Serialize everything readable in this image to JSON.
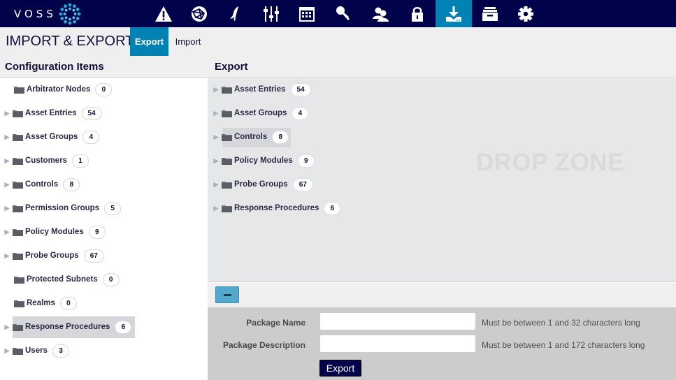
{
  "brand": {
    "name": "VOSS",
    "accent": "#0082b4",
    "nav_bg": "#01034a"
  },
  "nav": {
    "icons": [
      {
        "name": "alert-icon",
        "label": "Alerts"
      },
      {
        "name": "globe-network-icon",
        "label": "Network"
      },
      {
        "name": "rocket-icon",
        "label": "Deploy"
      },
      {
        "name": "sliders-icon",
        "label": "Controls"
      },
      {
        "name": "calendar-icon",
        "label": "Schedule"
      },
      {
        "name": "key-icon",
        "label": "Keys"
      },
      {
        "name": "users-icon",
        "label": "Users"
      },
      {
        "name": "lock-icon",
        "label": "Security"
      },
      {
        "name": "download-icon",
        "label": "Import & Export",
        "active": true
      },
      {
        "name": "archive-icon",
        "label": "Archive"
      },
      {
        "name": "gear-icon",
        "label": "Settings"
      }
    ]
  },
  "page": {
    "title": "IMPORT & EXPORT",
    "tabs": [
      {
        "label": "Export",
        "active": true
      },
      {
        "label": "Import",
        "active": false
      }
    ]
  },
  "config_items": {
    "header": "Configuration Items",
    "items": [
      {
        "label": "Arbitrator Nodes",
        "count": "0",
        "expandable": false
      },
      {
        "label": "Asset Entries",
        "count": "54",
        "expandable": true
      },
      {
        "label": "Asset Groups",
        "count": "4",
        "expandable": true
      },
      {
        "label": "Customers",
        "count": "1",
        "expandable": true
      },
      {
        "label": "Controls",
        "count": "8",
        "expandable": true
      },
      {
        "label": "Permission Groups",
        "count": "5",
        "expandable": true
      },
      {
        "label": "Policy Modules",
        "count": "9",
        "expandable": true
      },
      {
        "label": "Probe Groups",
        "count": "67",
        "expandable": true
      },
      {
        "label": "Protected Subnets",
        "count": "0",
        "expandable": false
      },
      {
        "label": "Realms",
        "count": "0",
        "expandable": false
      },
      {
        "label": "Response Procedures",
        "count": "6",
        "expandable": true,
        "highlighted": true
      },
      {
        "label": "Users",
        "count": "3",
        "expandable": true
      }
    ]
  },
  "export": {
    "header": "Export",
    "drop_zone_label": "DROP ZONE",
    "items": [
      {
        "label": "Asset Entries",
        "count": "54"
      },
      {
        "label": "Asset Groups",
        "count": "4"
      },
      {
        "label": "Controls",
        "count": "8",
        "highlighted": true
      },
      {
        "label": "Policy Modules",
        "count": "9"
      },
      {
        "label": "Probe Groups",
        "count": "67"
      },
      {
        "label": "Response Procedures",
        "count": "6"
      }
    ],
    "remove_button_label": "−"
  },
  "form": {
    "package_name": {
      "label": "Package Name",
      "value": "",
      "placeholder": "",
      "hint": "Must be between 1 and 32 characters long"
    },
    "package_description": {
      "label": "Package Description",
      "value": "",
      "placeholder": "",
      "hint": "Must be between 1 and 172 characters long"
    },
    "submit_label": "Export"
  }
}
